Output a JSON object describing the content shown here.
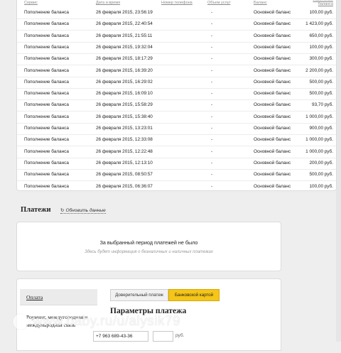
{
  "table": {
    "headers": {
      "service": "Сервис",
      "datetime": "Дата и время",
      "phone": "Номер телефона",
      "services": "Объем услуг",
      "balance": "Баланс",
      "change": "Изменение баланса"
    },
    "rows": [
      {
        "service": "Пополнение баланса",
        "datetime": "26 февраля 2015, 23:56:19",
        "phone": "-",
        "balance": "Основной баланс",
        "amount": "100,00 руб."
      },
      {
        "service": "Пополнение баланса",
        "datetime": "26 февраля 2015, 22:40:54",
        "phone": "-",
        "balance": "Основной баланс",
        "amount": "1 423,00 руб."
      },
      {
        "service": "Пополнение баланса",
        "datetime": "26 февраля 2015, 21:55:11",
        "phone": "-",
        "balance": "Основной баланс",
        "amount": "650,00 руб."
      },
      {
        "service": "Пополнение баланса",
        "datetime": "26 февраля 2015, 19:32:04",
        "phone": "-",
        "balance": "Основной баланс",
        "amount": "100,00 руб."
      },
      {
        "service": "Пополнение баланса",
        "datetime": "26 февраля 2015, 18:17:29",
        "phone": "-",
        "balance": "Основной баланс",
        "amount": "300,00 руб."
      },
      {
        "service": "Пополнение баланса",
        "datetime": "26 февраля 2015, 16:39:20",
        "phone": "-",
        "balance": "Основной баланс",
        "amount": "2 200,00 руб."
      },
      {
        "service": "Пополнение баланса",
        "datetime": "26 февраля 2015, 16:29:02",
        "phone": "-",
        "balance": "Основной баланс",
        "amount": "500,00 руб."
      },
      {
        "service": "Пополнение баланса",
        "datetime": "26 февраля 2015, 16:09:10",
        "phone": "-",
        "balance": "Основной баланс",
        "amount": "500,00 руб."
      },
      {
        "service": "Пополнение баланса",
        "datetime": "26 февраля 2015, 15:58:29",
        "phone": "-",
        "balance": "Основной баланс",
        "amount": "93,70 руб."
      },
      {
        "service": "Пополнение баланса",
        "datetime": "26 февраля 2015, 15:38:40",
        "phone": "-",
        "balance": "Основной баланс",
        "amount": "1 000,00 руб."
      },
      {
        "service": "Пополнение баланса",
        "datetime": "26 февраля 2015, 13:23:01",
        "phone": "-",
        "balance": "Основной баланс",
        "amount": "900,00 руб."
      },
      {
        "service": "Пополнение баланса",
        "datetime": "26 февраля 2015, 12:33:08",
        "phone": "-",
        "balance": "Основной баланс",
        "amount": "1 000,00 руб."
      },
      {
        "service": "Пополнение баланса",
        "datetime": "26 февраля 2015, 12:22:48",
        "phone": "-",
        "balance": "Основной баланс",
        "amount": "1 000,00 руб."
      },
      {
        "service": "Пополнение баланса",
        "datetime": "26 февраля 2015, 12:13:10",
        "phone": "-",
        "balance": "Основной баланс",
        "amount": "200,00 руб."
      },
      {
        "service": "Пополнение баланса",
        "datetime": "26 февраля 2015, 08:50:57",
        "phone": "-",
        "balance": "Основной баланс",
        "amount": "500,00 руб."
      },
      {
        "service": "Пополнение баланса",
        "datetime": "26 февраля 2015, 06:36:07",
        "phone": "-",
        "balance": "Основной баланс",
        "amount": "100,00 руб."
      }
    ]
  },
  "payments": {
    "title": "Платежи",
    "refresh_label": "Обновить данные",
    "refresh_icon": "refresh-icon",
    "empty_message": "За выбранный период платежей не было",
    "empty_hint": "Здесь будет информация о безналичных и наличных платежах"
  },
  "params": {
    "side_items": [
      "Оплата",
      "Роуминг, междугородная и международная связь"
    ],
    "tabs": [
      "Доверительный платеж",
      "Банковской картой"
    ],
    "active_tab": "Банковской картой",
    "title": "Параметры платежа",
    "phone_value": "+7 963 689-43-36",
    "currency": "руб."
  },
  "watermark": "www.baby.ru/u/alysik79",
  "colors": {
    "accent": "#f5c518",
    "background": "#eeeeee"
  }
}
